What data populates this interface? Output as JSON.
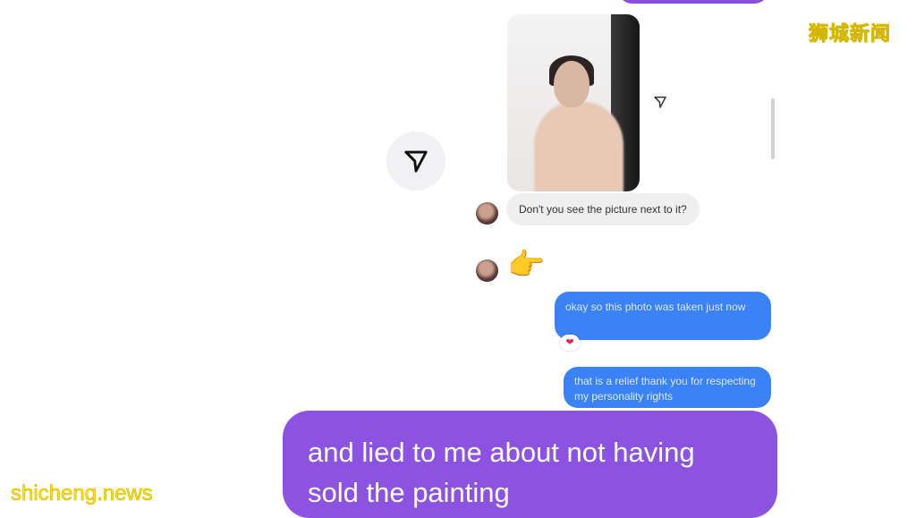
{
  "chat": {
    "received_message": "Don't you see the picture next to it?",
    "received_emoji": "👉",
    "sent_message_1": "okay so this photo was taken just now",
    "sent_message_1_reaction": "❤",
    "sent_message_2": "that is a relief thank you for respecting my personality rights"
  },
  "subtitle": "and lied to me about not having sold the painting",
  "watermarks": {
    "top_right": "狮城新闻",
    "bottom_left": "shicheng.news"
  },
  "icons": {
    "share": "send-icon"
  },
  "colors": {
    "sent_bubble": "#3b82f6",
    "subtitle_bubble": "#8c52e2",
    "received_bubble": "#efefef",
    "watermark": "#ffe600"
  }
}
